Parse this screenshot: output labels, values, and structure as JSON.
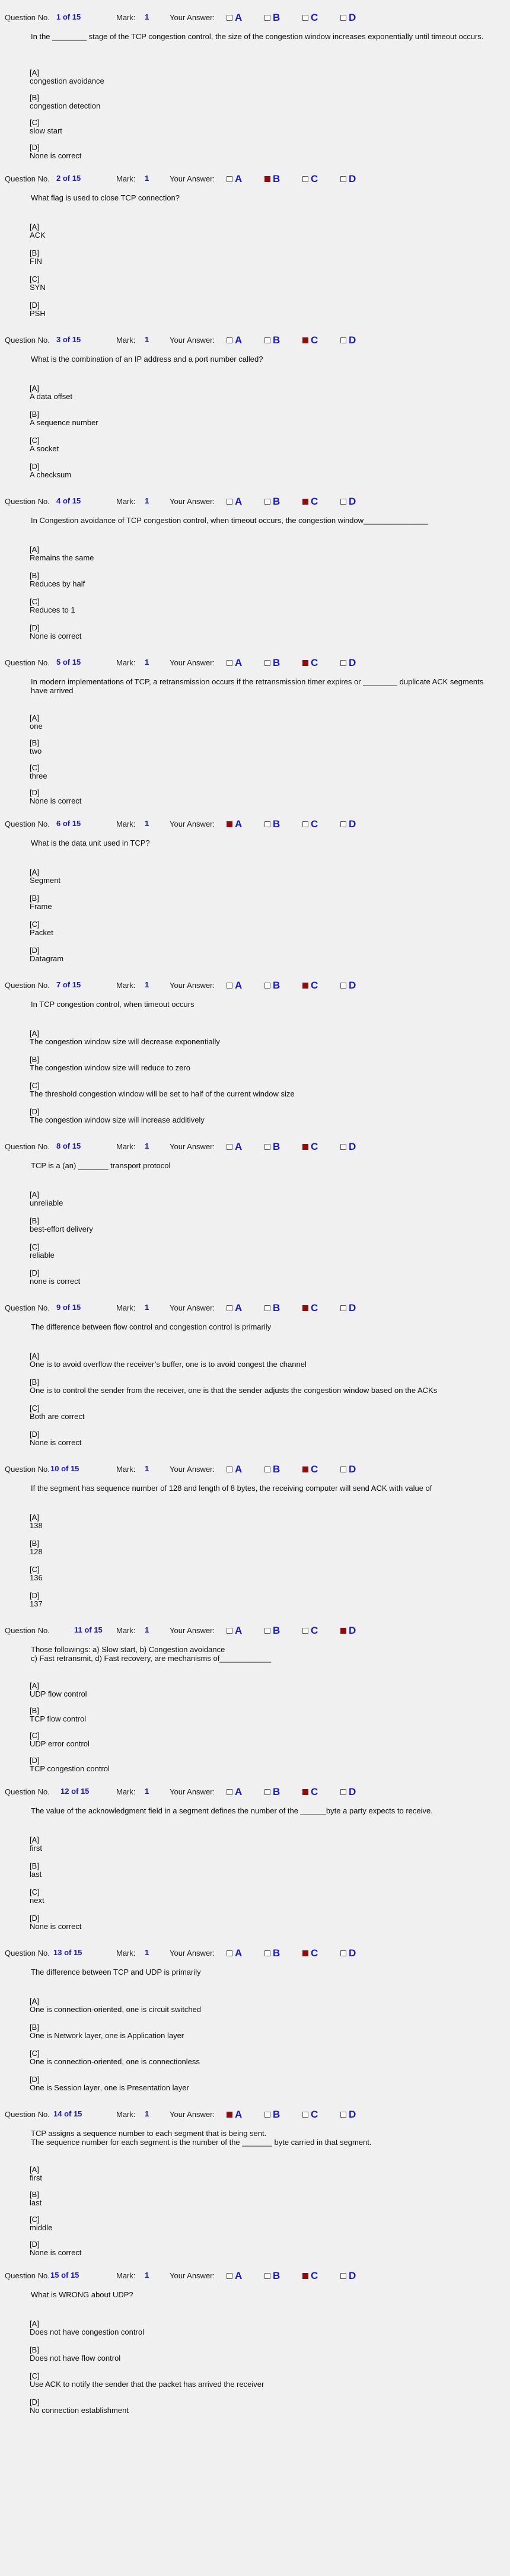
{
  "labels": {
    "question_no": "Question No.",
    "mark": "Mark:",
    "your_answer": "Your Answer:"
  },
  "colors": {
    "accent": "#1a1acc",
    "selected": "#8b0d0d",
    "background": "#f0f0f0"
  },
  "option_letters": [
    "A",
    "B",
    "C",
    "D"
  ],
  "choice_tags": [
    "[A]",
    "[B]",
    "[C]",
    "[D]"
  ],
  "questions": [
    {
      "number": "1 of 15",
      "mark": "1",
      "selected": null,
      "text": "In the ________ stage of the TCP congestion control, the size of the congestion window increases exponentially until timeout occurs.",
      "choices": [
        "congestion avoidance",
        "congestion detection",
        "slow start",
        "None is correct"
      ]
    },
    {
      "number": "2 of 15",
      "mark": "1",
      "selected": "B",
      "text": "What flag is used to close TCP connection?",
      "choices": [
        "ACK",
        "FIN",
        "SYN",
        "PSH"
      ]
    },
    {
      "number": "3 of 15",
      "mark": "1",
      "selected": "C",
      "text": "What is the combination of an IP address and a port number called?",
      "choices": [
        "A data offset",
        "A sequence number",
        "A socket",
        "A checksum"
      ]
    },
    {
      "number": "4 of 15",
      "mark": "1",
      "selected": "C",
      "text": "In Congestion avoidance of TCP congestion control, when timeout occurs, the congestion window_______________",
      "choices": [
        "Remains the same",
        "Reduces by half",
        "Reduces to 1",
        "None is correct"
      ]
    },
    {
      "number": "5 of 15",
      "mark": "1",
      "selected": "C",
      "text": "In modern implementations of TCP, a retransmission occurs if the retransmission timer expires or ________ duplicate ACK segments have arrived",
      "choices": [
        "one",
        "two",
        "three",
        "None is correct"
      ]
    },
    {
      "number": "6 of 15",
      "mark": "1",
      "selected": "A",
      "text": "What is the data unit used in TCP?",
      "choices": [
        "Segment",
        "Frame",
        "Packet",
        "Datagram"
      ]
    },
    {
      "number": "7 of 15",
      "mark": "1",
      "selected": "C",
      "text": "In TCP congestion control, when timeout occurs",
      "choices": [
        "The congestion window size will decrease exponentially",
        "The congestion window size  will reduce to zero",
        "The threshold congestion window will be set to half of the current window size",
        "The congestion window  size will increase additively"
      ]
    },
    {
      "number": "8 of 15",
      "mark": "1",
      "selected": "C",
      "text": "TCP is a (an) _______ transport protocol",
      "choices": [
        "unreliable",
        "best-effort delivery",
        "reliable",
        "none is correct"
      ]
    },
    {
      "number": "9 of 15",
      "mark": "1",
      "selected": "C",
      "text": "The difference between flow control and congestion control is primarily",
      "choices": [
        "One is to avoid overflow the receiver’s buffer, one is to avoid congest the channel",
        "One is to control the sender from the receiver, one is  that the sender adjusts the congestion window based on the ACKs",
        "Both are correct",
        "None is correct"
      ]
    },
    {
      "number": "10 of 15",
      "mark": "1",
      "selected": "C",
      "text": "If the segment has sequence number of 128 and length of 8 bytes, the receiving computer will send ACK with value of",
      "choices": [
        "138",
        "128",
        "136",
        "137"
      ]
    },
    {
      "number": "11 of 15",
      "mark": "1",
      "selected": "D",
      "text": "Those followings:  a) Slow start, b) Congestion avoidance\nc) Fast retransmit, d) Fast recovery, are mechanisms of____________",
      "choices": [
        "UDP flow control",
        "TCP flow control",
        "UDP error control",
        "TCP congestion control"
      ]
    },
    {
      "number": "12 of 15",
      "mark": "1",
      "selected": "C",
      "text": "The value of the acknowledgment field in a segment defines the number of the ______byte a party expects to receive.",
      "choices": [
        "first",
        "last",
        "next",
        "None is correct"
      ]
    },
    {
      "number": "13 of 15",
      "mark": "1",
      "selected": "C",
      "text": "The difference between TCP and UDP is primarily",
      "choices": [
        "One is connection-oriented, one is circuit switched",
        "One is Network layer, one is Application layer",
        "One is connection-oriented, one is connectionless",
        "One is Session layer, one is Presentation layer"
      ]
    },
    {
      "number": "14 of 15",
      "mark": "1",
      "selected": "A",
      "text": "TCP assigns a sequence number to each segment that is being sent.\nThe sequence number for each segment is the number of the _______ byte carried in that segment.",
      "choices": [
        "first",
        "last",
        "middle",
        "None is correct"
      ]
    },
    {
      "number": "15 of 15",
      "mark": "1",
      "selected": "C",
      "text": "What is WRONG about UDP?",
      "choices": [
        "Does not have congestion control",
        "Does not have flow control",
        "Use ACK to notify the sender that the packet has arrived the receiver",
        "No connection establishment"
      ]
    }
  ]
}
